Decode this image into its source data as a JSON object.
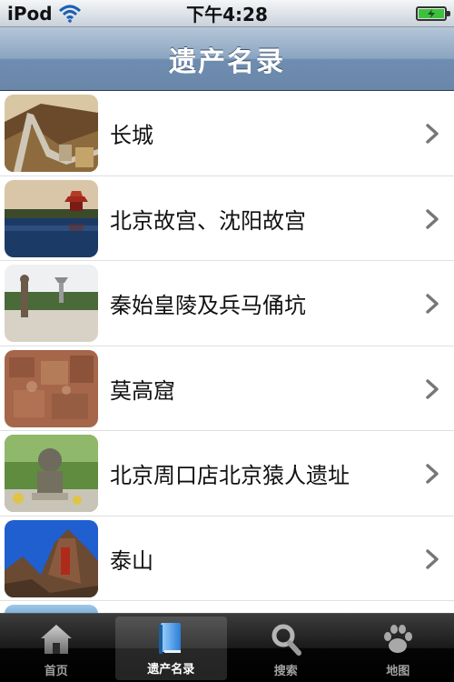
{
  "status_bar": {
    "carrier": "iPod",
    "time": "下午4:28",
    "icons": [
      "wifi-icon",
      "battery-icon"
    ]
  },
  "nav_bar": {
    "title": "遗产名录"
  },
  "list": {
    "items": [
      {
        "label": "长城",
        "thumbnail": "great-wall-photo"
      },
      {
        "label": "北京故宫、沈阳故宫",
        "thumbnail": "forbidden-city-photo"
      },
      {
        "label": "秦始皇陵及兵马俑坑",
        "thumbnail": "qin-mausoleum-photo"
      },
      {
        "label": "莫高窟",
        "thumbnail": "mogao-caves-photo"
      },
      {
        "label": "北京周口店北京猿人遗址",
        "thumbnail": "zhoukoudian-photo"
      },
      {
        "label": "泰山",
        "thumbnail": "mount-tai-photo"
      }
    ]
  },
  "tab_bar": {
    "tabs": [
      {
        "label": "首页",
        "icon": "home-icon",
        "active": false
      },
      {
        "label": "遗产名录",
        "icon": "book-icon",
        "active": true
      },
      {
        "label": "搜索",
        "icon": "search-icon",
        "active": false
      },
      {
        "label": "地图",
        "icon": "paw-icon",
        "active": false
      }
    ]
  },
  "colors": {
    "nav_bar": "#7f9bbb",
    "tab_bar": "#1a1a1a",
    "active_tab_label": "#ffffff",
    "inactive_tab_label": "#a0a0a0"
  }
}
